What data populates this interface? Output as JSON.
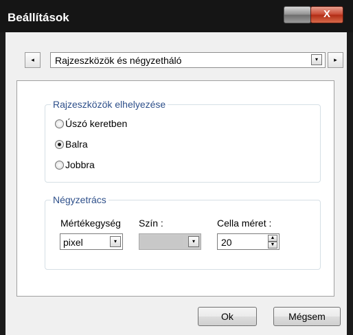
{
  "window": {
    "title": "Beállítások",
    "close_glyph": "X"
  },
  "nav": {
    "prev_icon": "arrow-left-icon",
    "next_icon": "arrow-right-icon",
    "prev_glyph": "◂",
    "next_glyph": "▸"
  },
  "category_select": {
    "value": "Rajzeszközök és négyzetháló",
    "arrow_glyph": "▾"
  },
  "toolbox_group": {
    "legend": "Rajzeszközök elhelyezése",
    "options": [
      {
        "label": "Úszó keretben",
        "selected": false
      },
      {
        "label": "Balra",
        "selected": true
      },
      {
        "label": "Jobbra",
        "selected": false
      }
    ]
  },
  "grid_group": {
    "legend": "Négyzetrács",
    "unit_label": "Mértékegység",
    "unit_value": "pixel",
    "color_label": "Szín :",
    "color_value": "#c8c8c8",
    "cell_size_label": "Cella méret :",
    "cell_size_value": "20"
  },
  "buttons": {
    "ok": "Ok",
    "cancel": "Mégsem"
  },
  "colors": {
    "titlebar": "#151515",
    "close_button": "#c74530",
    "group_legend": "#2d4f8a",
    "dialog_background": "#f0f0f0"
  }
}
